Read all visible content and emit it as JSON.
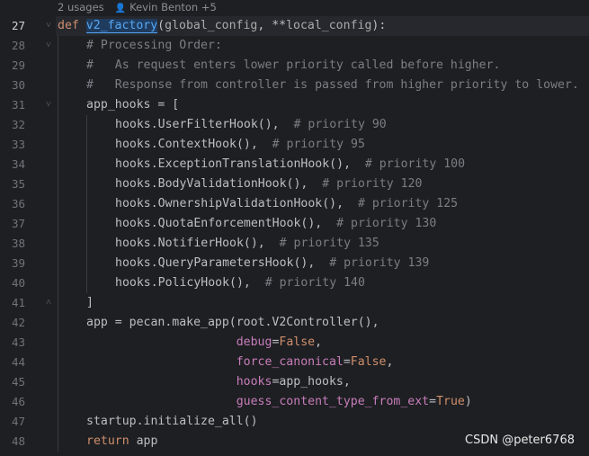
{
  "inlay_hint": {
    "usages": "2 usages",
    "author": "Kevin Benton +5",
    "user_icon": "person-icon"
  },
  "current_line": 27,
  "line_numbers": [
    27,
    28,
    29,
    30,
    31,
    32,
    33,
    34,
    35,
    36,
    37,
    38,
    39,
    40,
    41,
    42,
    43,
    44,
    45,
    46,
    47,
    48
  ],
  "lines": [
    {
      "n": 27,
      "indent": 0,
      "fold": "down",
      "tokens": [
        {
          "t": "def ",
          "c": "kw"
        },
        {
          "t": "v2_factory",
          "c": "fn-hl"
        },
        {
          "t": "(",
          "c": "id"
        },
        {
          "t": "global_config",
          "c": "param"
        },
        {
          "t": ", **",
          "c": "id"
        },
        {
          "t": "local_config",
          "c": "param"
        },
        {
          "t": "):",
          "c": "id"
        }
      ]
    },
    {
      "n": 28,
      "indent": 1,
      "fold": "down",
      "tokens": [
        {
          "t": "# Processing Order:",
          "c": "cm"
        }
      ]
    },
    {
      "n": 29,
      "indent": 1,
      "tokens": [
        {
          "t": "#   As request enters lower priority called before higher.",
          "c": "cm"
        }
      ]
    },
    {
      "n": 30,
      "indent": 1,
      "tokens": [
        {
          "t": "#   Response from controller is passed from higher priority to lower.",
          "c": "cm"
        }
      ]
    },
    {
      "n": 31,
      "indent": 1,
      "fold": "down",
      "tokens": [
        {
          "t": "app_hooks = [",
          "c": "id"
        }
      ]
    },
    {
      "n": 32,
      "indent": 2,
      "tokens": [
        {
          "t": "hooks.UserFilterHook(),  ",
          "c": "id"
        },
        {
          "t": "# priority 90",
          "c": "cm"
        }
      ]
    },
    {
      "n": 33,
      "indent": 2,
      "tokens": [
        {
          "t": "hooks.ContextHook(),  ",
          "c": "id"
        },
        {
          "t": "# priority 95",
          "c": "cm"
        }
      ]
    },
    {
      "n": 34,
      "indent": 2,
      "tokens": [
        {
          "t": "hooks.ExceptionTranslationHook(),  ",
          "c": "id"
        },
        {
          "t": "# priority 100",
          "c": "cm"
        }
      ]
    },
    {
      "n": 35,
      "indent": 2,
      "tokens": [
        {
          "t": "hooks.BodyValidationHook(),  ",
          "c": "id"
        },
        {
          "t": "# priority 120",
          "c": "cm"
        }
      ]
    },
    {
      "n": 36,
      "indent": 2,
      "tokens": [
        {
          "t": "hooks.OwnershipValidationHook(),  ",
          "c": "id"
        },
        {
          "t": "# priority 125",
          "c": "cm"
        }
      ]
    },
    {
      "n": 37,
      "indent": 2,
      "tokens": [
        {
          "t": "hooks.QuotaEnforcementHook(),  ",
          "c": "id"
        },
        {
          "t": "# priority 130",
          "c": "cm"
        }
      ]
    },
    {
      "n": 38,
      "indent": 2,
      "tokens": [
        {
          "t": "hooks.NotifierHook(),  ",
          "c": "id"
        },
        {
          "t": "# priority 135",
          "c": "cm"
        }
      ]
    },
    {
      "n": 39,
      "indent": 2,
      "tokens": [
        {
          "t": "hooks.QueryParametersHook(),  ",
          "c": "id"
        },
        {
          "t": "# priority 139",
          "c": "cm"
        }
      ]
    },
    {
      "n": 40,
      "indent": 2,
      "tokens": [
        {
          "t": "hooks.PolicyHook(),  ",
          "c": "id"
        },
        {
          "t": "# priority 140",
          "c": "cm"
        }
      ]
    },
    {
      "n": 41,
      "indent": 1,
      "fold": "up",
      "tokens": [
        {
          "t": "]",
          "c": "id"
        }
      ]
    },
    {
      "n": 42,
      "indent": 1,
      "tokens": [
        {
          "t": "app = pecan.make_app(root.V2Controller(),",
          "c": "id"
        }
      ]
    },
    {
      "n": 43,
      "indent": 1,
      "tokens": [
        {
          "t": "                     ",
          "c": "id"
        },
        {
          "t": "debug",
          "c": "kwarg"
        },
        {
          "t": "=",
          "c": "id"
        },
        {
          "t": "False",
          "c": "const"
        },
        {
          "t": ",",
          "c": "id"
        }
      ]
    },
    {
      "n": 44,
      "indent": 1,
      "tokens": [
        {
          "t": "                     ",
          "c": "id"
        },
        {
          "t": "force_canonical",
          "c": "kwarg"
        },
        {
          "t": "=",
          "c": "id"
        },
        {
          "t": "False",
          "c": "const"
        },
        {
          "t": ",",
          "c": "id"
        }
      ]
    },
    {
      "n": 45,
      "indent": 1,
      "tokens": [
        {
          "t": "                     ",
          "c": "id"
        },
        {
          "t": "hooks",
          "c": "kwarg"
        },
        {
          "t": "=app_hooks,",
          "c": "id"
        }
      ]
    },
    {
      "n": 46,
      "indent": 1,
      "tokens": [
        {
          "t": "                     ",
          "c": "id"
        },
        {
          "t": "guess_content_type_from_ext",
          "c": "kwarg"
        },
        {
          "t": "=",
          "c": "id"
        },
        {
          "t": "True",
          "c": "const"
        },
        {
          "t": ")",
          "c": "id"
        }
      ]
    },
    {
      "n": 47,
      "indent": 1,
      "tokens": [
        {
          "t": "startup.initialize_all()",
          "c": "id"
        }
      ]
    },
    {
      "n": 48,
      "indent": 1,
      "tokens": [
        {
          "t": "return ",
          "c": "kw"
        },
        {
          "t": "app",
          "c": "id"
        }
      ]
    }
  ],
  "watermark": "CSDN @peter6768",
  "colors": {
    "background": "#1e1f22",
    "keyword": "#cf8e6d",
    "function": "#56a8f5",
    "comment": "#7a7e85",
    "kwarg": "#c77dbb",
    "text": "#bcbec4"
  }
}
